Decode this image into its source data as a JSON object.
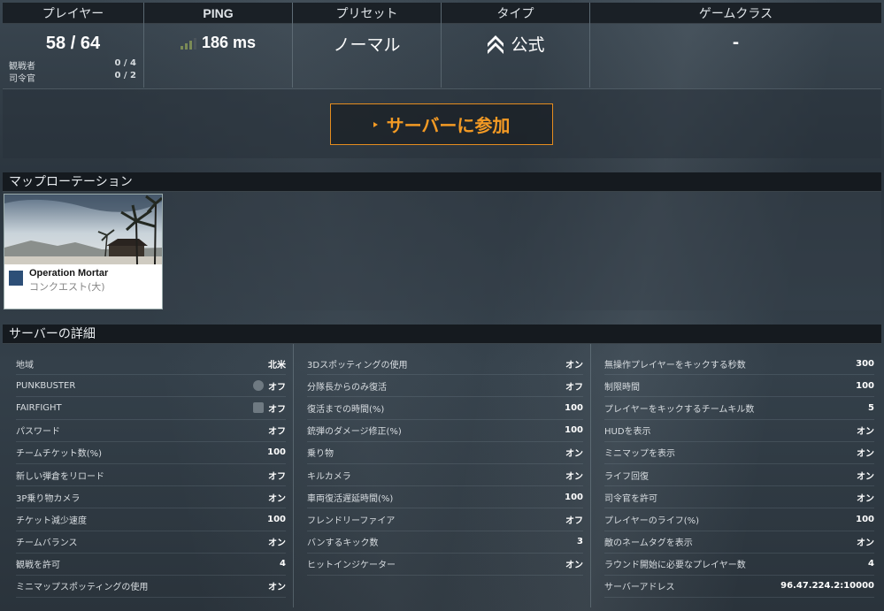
{
  "stats": {
    "players": {
      "header": "プレイヤー",
      "value": "58 / 64",
      "spectator_label": "観戦者",
      "spectator_value": "0 / 4",
      "commander_label": "司令官",
      "commander_value": "0 / 2"
    },
    "ping": {
      "header": "PING",
      "value": "186 ms",
      "signal_bars": 3,
      "bar_color": "#7a8a56"
    },
    "preset": {
      "header": "プリセット",
      "value": "ノーマル"
    },
    "type": {
      "header": "タイプ",
      "value": "公式",
      "icon": "rank-chevron-icon"
    },
    "game_class": {
      "header": "ゲームクラス",
      "value": "-"
    }
  },
  "join": {
    "label": "サーバーに参加",
    "accent": "#f39a24"
  },
  "map_rotation": {
    "title": "マップローテーション",
    "maps": [
      {
        "name": "Operation Mortar",
        "mode": "コンクエスト(大)",
        "mode_icon": "conquest-icon"
      }
    ]
  },
  "details": {
    "title": "サーバーの詳細",
    "columns": [
      [
        {
          "label": "地域",
          "value": "北米"
        },
        {
          "label": "PUNKBUSTER",
          "value": "オフ",
          "icon": "punkbuster-icon"
        },
        {
          "label": "FAIRFIGHT",
          "value": "オフ",
          "icon": "fairfight-icon"
        },
        {
          "label": "パスワード",
          "value": "オフ"
        },
        {
          "label": "チームチケット数(%)",
          "value": "100"
        },
        {
          "label": "新しい弾倉をリロード",
          "value": "オフ"
        },
        {
          "label": "3P乗り物カメラ",
          "value": "オン"
        },
        {
          "label": "チケット減少速度",
          "value": "100"
        },
        {
          "label": "チームバランス",
          "value": "オン"
        },
        {
          "label": "観戦を許可",
          "value": "4"
        },
        {
          "label": "ミニマップスポッティングの使用",
          "value": "オン"
        }
      ],
      [
        {
          "label": "3Dスポッティングの使用",
          "value": "オン"
        },
        {
          "label": "分隊長からのみ復活",
          "value": "オフ"
        },
        {
          "label": "復活までの時間(%)",
          "value": "100"
        },
        {
          "label": "銃弾のダメージ修正(%)",
          "value": "100"
        },
        {
          "label": "乗り物",
          "value": "オン"
        },
        {
          "label": "キルカメラ",
          "value": "オン"
        },
        {
          "label": "車両復活遅延時間(%)",
          "value": "100"
        },
        {
          "label": "フレンドリーファイア",
          "value": "オフ"
        },
        {
          "label": "バンするキック数",
          "value": "3"
        },
        {
          "label": "ヒットインジケーター",
          "value": "オン"
        }
      ],
      [
        {
          "label": "無操作プレイヤーをキックする秒数",
          "value": "300"
        },
        {
          "label": "制限時間",
          "value": "100"
        },
        {
          "label": "プレイヤーをキックするチームキル数",
          "value": "5"
        },
        {
          "label": "HUDを表示",
          "value": "オン"
        },
        {
          "label": "ミニマップを表示",
          "value": "オン"
        },
        {
          "label": "ライフ回復",
          "value": "オン"
        },
        {
          "label": "司令官を許可",
          "value": "オン"
        },
        {
          "label": "プレイヤーのライフ(%)",
          "value": "100"
        },
        {
          "label": "敵のネームタグを表示",
          "value": "オン"
        },
        {
          "label": "ラウンド開始に必要なプレイヤー数",
          "value": "4"
        },
        {
          "label": "サーバーアドレス",
          "value": "96.47.224.2:10000"
        }
      ]
    ]
  }
}
